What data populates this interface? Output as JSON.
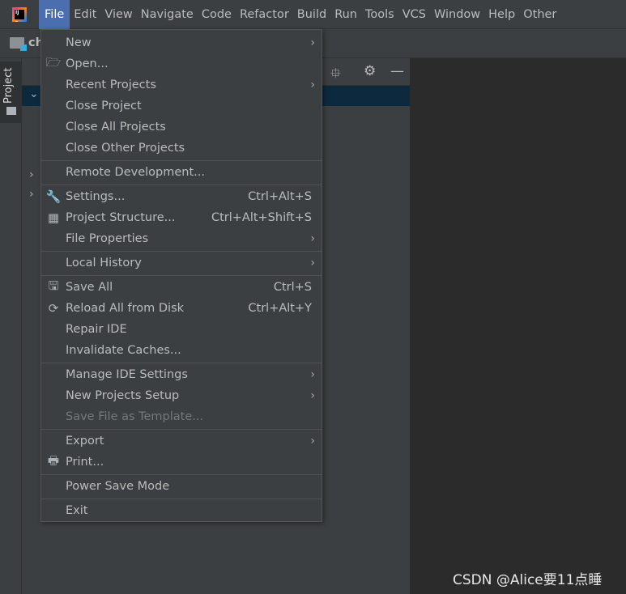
{
  "menubar": {
    "items": [
      "File",
      "Edit",
      "View",
      "Navigate",
      "Code",
      "Refactor",
      "Build",
      "Run",
      "Tools",
      "VCS",
      "Window",
      "Help",
      "Other"
    ],
    "active": "File"
  },
  "breadcrumb": "ch",
  "sidebar": {
    "project_tab": "Project"
  },
  "file_menu": {
    "groups": [
      [
        {
          "label": "New",
          "submenu": true
        },
        {
          "label": "Open...",
          "icon": "folder-open-icon"
        },
        {
          "label": "Recent Projects",
          "submenu": true
        },
        {
          "label": "Close Project"
        },
        {
          "label": "Close All Projects"
        },
        {
          "label": "Close Other Projects"
        }
      ],
      [
        {
          "label": "Remote Development..."
        }
      ],
      [
        {
          "label": "Settings...",
          "icon": "wrench-icon",
          "shortcut": "Ctrl+Alt+S"
        },
        {
          "label": "Project Structure...",
          "icon": "project-structure-icon",
          "shortcut": "Ctrl+Alt+Shift+S"
        },
        {
          "label": "File Properties",
          "submenu": true
        }
      ],
      [
        {
          "label": "Local History",
          "submenu": true
        }
      ],
      [
        {
          "label": "Save All",
          "icon": "save-icon",
          "shortcut": "Ctrl+S"
        },
        {
          "label": "Reload All from Disk",
          "icon": "reload-icon",
          "shortcut": "Ctrl+Alt+Y"
        },
        {
          "label": "Repair IDE"
        },
        {
          "label": "Invalidate Caches..."
        }
      ],
      [
        {
          "label": "Manage IDE Settings",
          "submenu": true
        },
        {
          "label": "New Projects Setup",
          "submenu": true
        },
        {
          "label": "Save File as Template...",
          "disabled": true
        }
      ],
      [
        {
          "label": "Export",
          "submenu": true
        },
        {
          "label": "Print...",
          "icon": "print-icon"
        }
      ],
      [
        {
          "label": "Power Save Mode"
        }
      ],
      [
        {
          "label": "Exit"
        }
      ]
    ]
  },
  "watermark": "CSDN @Alice要11点睡",
  "colors": {
    "active_menu": "#4b6eaf",
    "selection": "#0d293e",
    "editor_bg": "#2b2b2b"
  }
}
